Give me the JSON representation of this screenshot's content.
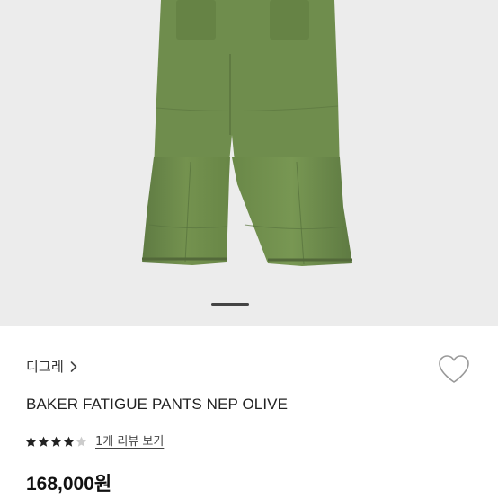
{
  "product": {
    "brand": "디그레",
    "title": "BAKER FATIGUE PANTS NEP OLIVE",
    "rating": 4,
    "rating_max": 5,
    "review_link": "1개 리뷰 보기",
    "price": "168,000원"
  },
  "gallery": {
    "image": "olive-fatigue-pants-photo",
    "current_page": 1
  },
  "colors": {
    "pants": "#6e8b50",
    "gallery_bg": "#ececec",
    "star_filled": "#222222",
    "star_empty": "#cccccc"
  },
  "icons": {
    "wishlist": "heart-outline-icon",
    "brand_link": "chevron-right-icon",
    "rating": "star-icon"
  }
}
